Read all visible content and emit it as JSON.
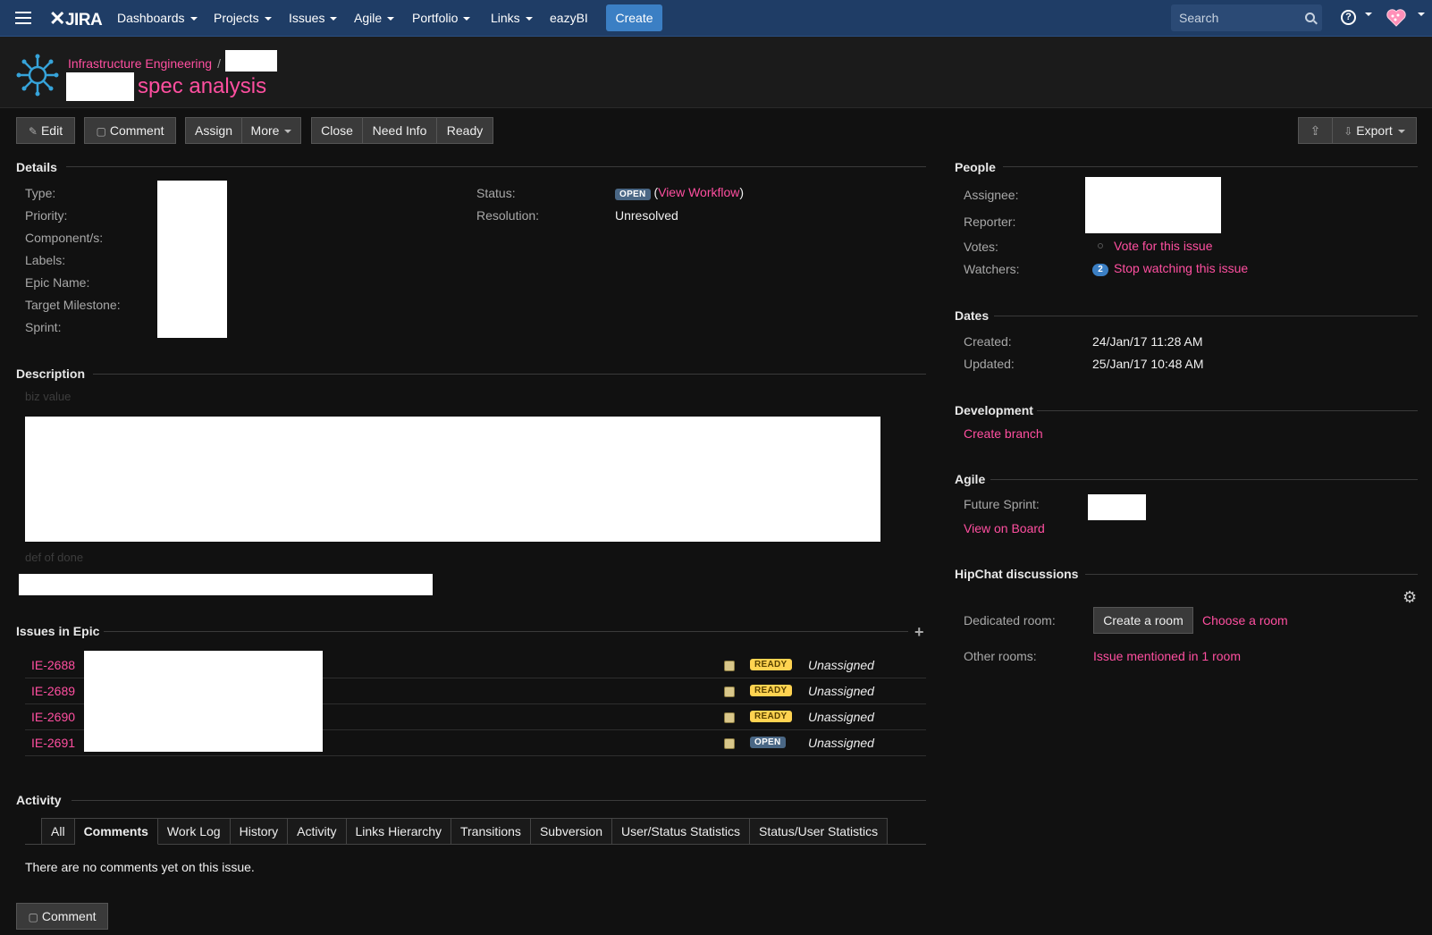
{
  "nav": {
    "logo": "JIRA",
    "items": [
      {
        "label": "Dashboards"
      },
      {
        "label": "Projects"
      },
      {
        "label": "Issues"
      },
      {
        "label": "Agile"
      },
      {
        "label": "Portfolio"
      },
      {
        "label": "Links"
      },
      {
        "label": "eazyBI"
      }
    ],
    "create": "Create",
    "search_placeholder": "Search",
    "help": "?"
  },
  "header": {
    "project": "Infrastructure Engineering",
    "separator": "/",
    "title": "spec analysis"
  },
  "toolbar": {
    "edit": "Edit",
    "comment": "Comment",
    "assign": "Assign",
    "more": "More",
    "close": "Close",
    "need_info": "Need Info",
    "ready": "Ready",
    "export": "Export"
  },
  "details": {
    "title": "Details",
    "labels": [
      "Type:",
      "Priority:",
      "Component/s:",
      "Labels:",
      "Epic Name:",
      "Target Milestone:",
      "Sprint:"
    ],
    "status_label": "Status:",
    "status": "OPEN",
    "view_workflow": "View Workflow",
    "resolution_label": "Resolution:",
    "resolution": "Unresolved"
  },
  "description": {
    "title": "Description",
    "biz_value": "biz value",
    "def_of_done": "def of done"
  },
  "epic": {
    "title": "Issues in Epic",
    "rows": [
      {
        "key": "IE-2688",
        "status": "READY",
        "assignee": "Unassigned"
      },
      {
        "key": "IE-2689",
        "status": "READY",
        "assignee": "Unassigned"
      },
      {
        "key": "IE-2690",
        "status": "READY",
        "assignee": "Unassigned"
      },
      {
        "key": "IE-2691",
        "status": "OPEN",
        "assignee": "Unassigned"
      }
    ]
  },
  "activity": {
    "title": "Activity",
    "tabs": [
      "All",
      "Comments",
      "Work Log",
      "History",
      "Activity",
      "Links Hierarchy",
      "Transitions",
      "Subversion",
      "User/Status Statistics",
      "Status/User Statistics"
    ],
    "empty": "There are no comments yet on this issue.",
    "comment_button": "Comment"
  },
  "people": {
    "title": "People",
    "assignee": "Assignee:",
    "reporter": "Reporter:",
    "votes": "Votes:",
    "votes_count": "0",
    "vote_link": "Vote for this issue",
    "watchers": "Watchers:",
    "watchers_count": "2",
    "watch_link": "Stop watching this issue"
  },
  "dates": {
    "title": "Dates",
    "created_label": "Created:",
    "created": "24/Jan/17 11:28 AM",
    "updated_label": "Updated:",
    "updated": "25/Jan/17 10:48 AM"
  },
  "development": {
    "title": "Development",
    "create_branch": "Create branch"
  },
  "agile": {
    "title": "Agile",
    "future_sprint": "Future Sprint:",
    "view_on_board": "View on Board"
  },
  "hipchat": {
    "title": "HipChat discussions",
    "dedicated_room": "Dedicated room:",
    "create_room": "Create a room",
    "choose_room": "Choose a room",
    "other_rooms": "Other rooms:",
    "mentioned": "Issue mentioned in 1 room"
  },
  "colors": {
    "nav_bg": "#1f3d66",
    "link": "#ff4fa0",
    "create": "#3b7fc4",
    "ready": "#ffd351",
    "open": "#4a6785"
  }
}
